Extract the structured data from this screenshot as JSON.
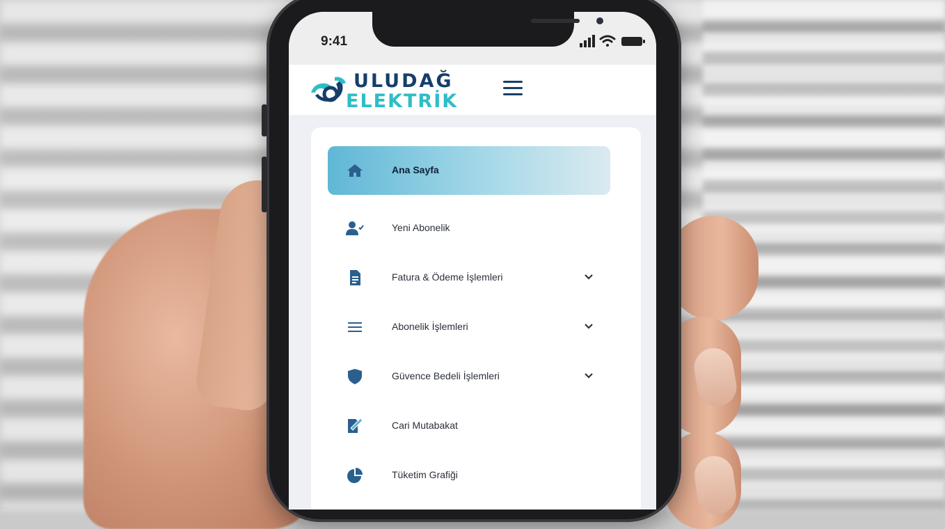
{
  "status_bar": {
    "time": "9:41",
    "icons": [
      "signal-icon",
      "wifi-icon",
      "battery-icon"
    ]
  },
  "header": {
    "logo_line1": "ULUDAĞ",
    "logo_line2": "ELEKTRİK",
    "menu_icon": "hamburger-menu-icon"
  },
  "menu": {
    "items": [
      {
        "label": "Ana Sayfa",
        "icon": "home-icon",
        "active": true,
        "expandable": false
      },
      {
        "label": "Yeni Abonelik",
        "icon": "user-check-icon",
        "active": false,
        "expandable": false
      },
      {
        "label": "Fatura & Ödeme İşlemleri",
        "icon": "document-icon",
        "active": false,
        "expandable": true
      },
      {
        "label": "Abonelik İşlemleri",
        "icon": "list-icon",
        "active": false,
        "expandable": true
      },
      {
        "label": "Güvence Bedeli İşlemleri",
        "icon": "shield-icon",
        "active": false,
        "expandable": true
      },
      {
        "label": "Cari Mutabakat",
        "icon": "edit-document-icon",
        "active": false,
        "expandable": false
      },
      {
        "label": "Tüketim Grafiği",
        "icon": "pie-chart-icon",
        "active": false,
        "expandable": false
      }
    ]
  },
  "colors": {
    "brand_dark": "#163e6a",
    "brand_teal": "#2dbdc8",
    "icon_blue": "#2b5f8e",
    "active_gradient_start": "#5fb7d6"
  }
}
